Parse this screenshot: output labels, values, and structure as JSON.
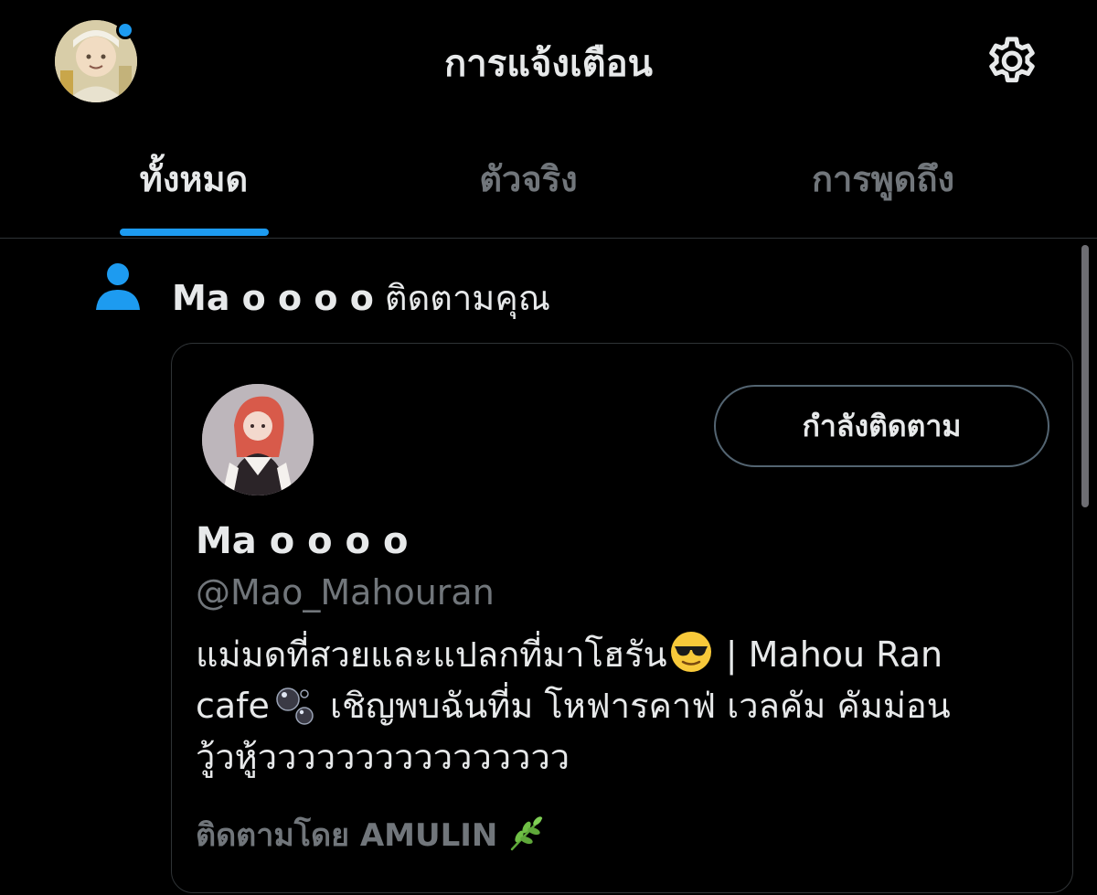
{
  "header": {
    "title": "การแจ้งเตือน",
    "settings_icon": "gear-icon",
    "avatar_badge_color": "#1d9bf0"
  },
  "tabs": [
    {
      "label": "ทั้งหมด",
      "active": true
    },
    {
      "label": "ตัวจริง",
      "active": false
    },
    {
      "label": "การพูดถึง",
      "active": false
    }
  ],
  "notification": {
    "icon": "person-icon",
    "actor_name": "Ma o o o o",
    "action_text": "ติดตามคุณ",
    "card": {
      "name": "Ma o o o o",
      "handle": "@Mao_Mahouran",
      "following_button": "กำลังติดตาม",
      "bio": {
        "line1_text": "แม่มดที่สวยและแปลกที่มาโฮรัน",
        "line1_emoji": "😎",
        "line1_suffix": "| Mahou Ran",
        "line2_prefix": "cafe",
        "line2_emoji": "🫧",
        "line2_text": "เชิญพบฉันที่ม โหฟารคาฟ่ เวลคัม คัมม่อน",
        "line3_text": "วู้วหู้วววววววววววววววว"
      },
      "followed_by": "ติดตามโดย AMULIN",
      "followed_by_emoji": "🌿"
    }
  },
  "colors": {
    "background": "#000000",
    "accent": "#1d9bf0",
    "primary_text": "#e7e9ea",
    "secondary_text": "#71767b",
    "border": "#2f3336"
  }
}
